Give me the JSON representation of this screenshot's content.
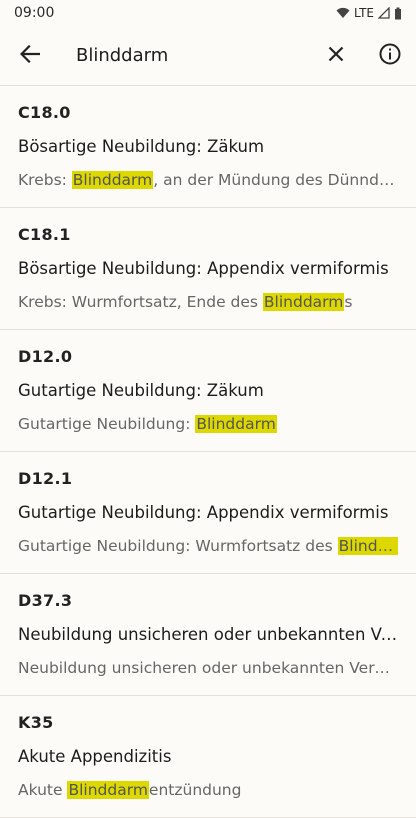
{
  "status": {
    "time": "09:00",
    "network": "LTE"
  },
  "search": {
    "query": "Blinddarm",
    "highlight_color": "#dcd800"
  },
  "results": [
    {
      "code": "C18.0",
      "title": "Bösartige Neubildung: Zäkum",
      "desc_before": "Krebs: ",
      "desc_match": "Blinddarm",
      "desc_after": ", an der Mündung des Dünndarms"
    },
    {
      "code": "C18.1",
      "title": "Bösartige Neubildung: Appendix vermiformis",
      "desc_before": "Krebs: Wurmfortsatz, Ende des ",
      "desc_match": "Blinddarm",
      "desc_after": "s"
    },
    {
      "code": "D12.0",
      "title": "Gutartige Neubildung: Zäkum",
      "desc_before": "Gutartige Neubildung: ",
      "desc_match": "Blinddarm",
      "desc_after": ""
    },
    {
      "code": "D12.1",
      "title": "Gutartige Neubildung: Appendix vermiformis",
      "desc_before": "Gutartige Neubildung: Wurmfortsatz des ",
      "desc_match": "Blinddarms",
      "desc_after": ""
    },
    {
      "code": "D37.3",
      "title": "Neubildung unsicheren oder unbekannten Verhaltens: Appendix vermiformis",
      "desc_before": "Neubildung unsicheren oder unbekannten Verhaltens: Wurmfortsatz",
      "desc_match": "",
      "desc_after": ""
    },
    {
      "code": "K35",
      "title": "Akute Appendizitis",
      "desc_before": "Akute ",
      "desc_match": "Blinddarm",
      "desc_after": "entzündung"
    }
  ]
}
